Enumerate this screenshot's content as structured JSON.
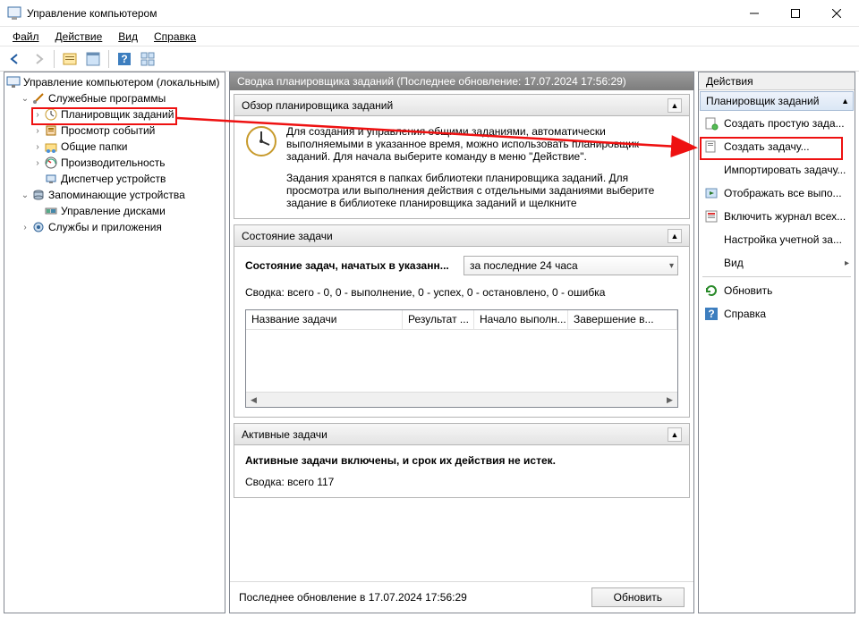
{
  "window": {
    "title": "Управление компьютером"
  },
  "menu": {
    "file": "Файл",
    "action": "Действие",
    "view": "Вид",
    "help": "Справка"
  },
  "tree": {
    "root": "Управление компьютером (локальным)",
    "tools": "Служебные программы",
    "scheduler": "Планировщик заданий",
    "eventviewer": "Просмотр событий",
    "sharedfolders": "Общие папки",
    "perf": "Производительность",
    "devmgr": "Диспетчер устройств",
    "storage": "Запоминающие устройства",
    "diskmgmt": "Управление дисками",
    "services": "Службы и приложения"
  },
  "center": {
    "header": "Сводка планировщика заданий (Последнее обновление: 17.07.2024 17:56:29)",
    "overview_title": "Обзор планировщика заданий",
    "overview_text1": "Для создания и управления общими заданиями, автоматически выполняемыми в указанное время, можно использовать планировщик заданий. Для начала выберите команду в меню \"Действие\".",
    "overview_text2": "Задания хранятся в папках библиотеки планировщика заданий. Для просмотра или выполнения действия с отдельными заданиями выберите задание в библиотеке планировщика заданий и щелкните",
    "status_title": "Состояние задачи",
    "status_label": "Состояние задач, начатых в указанн...",
    "status_combo": "за последние 24 часа",
    "status_summary": "Сводка: всего - 0, 0 - выполнение, 0 - успех, 0 - остановлено, 0 - ошибка",
    "col_name": "Название задачи",
    "col_result": "Результат ...",
    "col_start": "Начало выполн...",
    "col_end": "Завершение в...",
    "active_title": "Активные задачи",
    "active_text": "Активные задачи включены, и срок их действия не истек.",
    "active_summary": "Сводка: всего 117",
    "footer_text": "Последнее обновление в 17.07.2024 17:56:29",
    "refresh_btn": "Обновить"
  },
  "actions": {
    "header": "Действия",
    "section": "Планировщик заданий",
    "create_basic": "Создать простую зада...",
    "create_task": "Создать задачу...",
    "import": "Импортировать задачу...",
    "show_running": "Отображать все выпо...",
    "enable_history": "Включить журнал всех...",
    "account_config": "Настройка учетной за...",
    "view": "Вид",
    "refresh": "Обновить",
    "help": "Справка"
  }
}
